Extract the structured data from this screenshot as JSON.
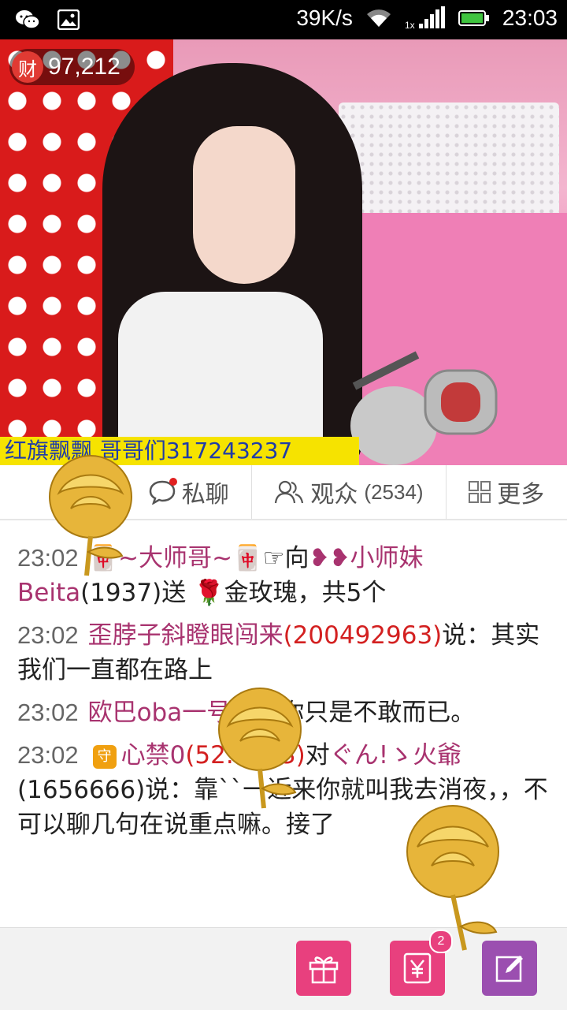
{
  "status_bar": {
    "speed": "39K/s",
    "time": "23:03",
    "network_label": "1x",
    "left_icons": [
      "wechat-icon",
      "gallery-icon"
    ],
    "right_icons": [
      "wifi-icon",
      "signal-icon",
      "battery-icon"
    ]
  },
  "video": {
    "balance_prefix": "财",
    "balance_value": "97,212",
    "ticker_text": "红旗飘飘  哥哥们317243237"
  },
  "tabs": [
    {
      "label": "私聊",
      "icon": "chat-bubble-icon"
    },
    {
      "label": "观众",
      "count": "(2534)",
      "icon": "audience-icon"
    },
    {
      "label": "更多",
      "icon": "grid-icon"
    }
  ],
  "chat": {
    "messages": [
      {
        "time": "23:02",
        "parts": [
          {
            "text": "🀄~大师哥~🀄",
            "style": "nm"
          },
          {
            "text": "☞向",
            "style": "plain"
          },
          {
            "text": "❥❥小师妹Beita",
            "style": "nm"
          },
          {
            "text": "(1937)送 🌹金玫瑰，共5个",
            "style": "plain"
          }
        ]
      },
      {
        "time": "23:02",
        "parts": [
          {
            "text": "歪脖子斜瞪眼闯来",
            "style": "nm"
          },
          {
            "text": "(200492963)",
            "style": "id"
          },
          {
            "text": "说：其实我们一直都在路上",
            "style": "plain"
          }
        ]
      },
      {
        "time": "23:02",
        "parts": [
          {
            "text": "欧巴oba一号",
            "style": "nm"
          },
          {
            "text": "说：你只是不敢而已。",
            "style": "plain"
          }
        ]
      },
      {
        "time": "23:02",
        "badge": "守",
        "parts": [
          {
            "text": "心禁0",
            "style": "nm"
          },
          {
            "text": "(52.1123)",
            "style": "id"
          },
          {
            "text": "对",
            "style": "plain"
          },
          {
            "text": "ぐん!ゝ火爺",
            "style": "nm"
          },
          {
            "text": "(1656666)说：靠``一近来你就叫我去消夜，，不可以聊几句在说重点嘛。接了",
            "style": "plain"
          }
        ]
      }
    ]
  },
  "bottom_bar": {
    "buttons": [
      {
        "name": "gift-button",
        "icon": "gift-icon",
        "color": "#e8407e"
      },
      {
        "name": "recharge-button",
        "icon": "yuan-icon",
        "color": "#e8407e",
        "badge": "2"
      },
      {
        "name": "compose-button",
        "icon": "edit-icon",
        "color": "#9b4fb0"
      }
    ]
  },
  "overlay": {
    "effect_icons": [
      "golden-rose-icon",
      "golden-rose-icon",
      "golden-rose-icon"
    ]
  },
  "colors": {
    "name": "#a8336f",
    "id": "#d32020",
    "ticker_bg": "#f6e300",
    "ticker_text": "#1f3ca8",
    "gift_pink": "#e8407e",
    "compose_purple": "#9b4fb0"
  }
}
